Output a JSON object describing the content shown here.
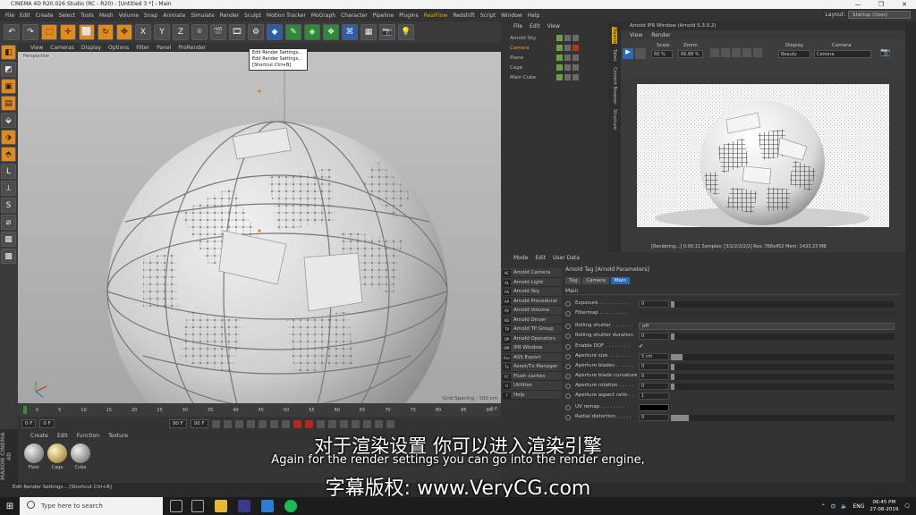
{
  "window": {
    "title": "CINEMA 4D R20.026 Studio (RC - R20) - [Untitled 3 *] - Main",
    "controls": [
      "—",
      "❐",
      "✕"
    ]
  },
  "menubar": {
    "items": [
      "File",
      "Edit",
      "Create",
      "Select",
      "Tools",
      "Mesh",
      "Volume",
      "Snap",
      "Animate",
      "Simulate",
      "Render",
      "Sculpt",
      "Motion Tracker",
      "MoGraph",
      "Character",
      "Pipeline",
      "Plugins"
    ],
    "highlight": "RealFlow",
    "items_after": [
      "Redshift",
      "Script",
      "Window",
      "Help"
    ],
    "layout_label": "Layout:",
    "layout_value": "Startup (User)"
  },
  "toolbar": {
    "tooltip": [
      "Edit Render Settings...",
      "Edit Render Settings...",
      "[Shortcut Ctrl+B]"
    ],
    "axis_x": "X",
    "axis_y": "Y",
    "axis_z": "Z"
  },
  "viewport": {
    "menu": [
      "View",
      "Cameras",
      "Display",
      "Options",
      "Filter",
      "Panel",
      "ProRender"
    ],
    "label": "Perspective",
    "grid_spacing": "Grid Spacing : 100 cm"
  },
  "timeline": {
    "ticks": [
      "0",
      "5",
      "10",
      "15",
      "20",
      "25",
      "30",
      "35",
      "40",
      "45",
      "50",
      "55",
      "60",
      "65",
      "70",
      "75",
      "80",
      "85",
      "90"
    ],
    "end_label": "0 F",
    "start_field": "0 F",
    "min_field": "0 F",
    "max_field": "90 F",
    "max_field2": "90 F"
  },
  "material_manager": {
    "menu": [
      "Create",
      "Edit",
      "Function",
      "Texture"
    ],
    "materials": [
      "Floor",
      "Cage",
      "Cube"
    ]
  },
  "statusbar": {
    "text": "Edit Render Settings... [Shortcut Ctrl+B]"
  },
  "object_manager": {
    "menu": [
      "File",
      "Edit",
      "View"
    ],
    "objects": [
      {
        "name": "Arnold Sky",
        "selected": false
      },
      {
        "name": "Camera",
        "selected": true
      },
      {
        "name": "Plane",
        "selected": false
      },
      {
        "name": "Cage",
        "selected": false
      },
      {
        "name": "Main Cube",
        "selected": false
      }
    ]
  },
  "side_tabs": [
    "Objects",
    "Takes",
    "Content Browser",
    "Structure"
  ],
  "ipr": {
    "title": "Arnold IPR Window (Arnold 5.3.0.2)",
    "menu": [
      "View",
      "Render"
    ],
    "scale_label": "Scale",
    "scale_value": "60 %",
    "zoom_label": "Zoom",
    "zoom_value": "66.88 %",
    "display_label": "Display",
    "display_value": "Beauty",
    "camera_label": "Camera",
    "camera_value": "Camera",
    "status": "[Rendering...] 0:00:11  Samples: [3/2/2/2/2/2]  Res: 768x452  Mem: 1433.23 MB"
  },
  "attributes": {
    "menu": [
      "Mode",
      "Edit",
      "User Data"
    ],
    "plugin_list": [
      {
        "icon": "AC",
        "label": "Arnold Camera"
      },
      {
        "icon": "AL",
        "label": "Arnold Light"
      },
      {
        "icon": "AS",
        "label": "Arnold Sky"
      },
      {
        "icon": "AP",
        "label": "Arnold Procedural"
      },
      {
        "icon": "AV",
        "label": "Arnold Volume"
      },
      {
        "icon": "AD",
        "label": "Arnold Driver"
      },
      {
        "icon": "TP",
        "label": "Arnold TP Group"
      },
      {
        "icon": "OP",
        "label": "Arnold Operators"
      },
      {
        "icon": "IPR",
        "label": "IPR Window"
      },
      {
        "icon": "Ass",
        "label": "ASS Export"
      },
      {
        "icon": "Tx",
        "label": "Asset/Tx Manager"
      },
      {
        "icon": "FC",
        "label": "Flush caches"
      },
      {
        "icon": "U",
        "label": "Utilities"
      },
      {
        "icon": "?",
        "label": "Help"
      }
    ],
    "header": "Arnold Tag [Arnold Parameters]",
    "tabs": [
      "Tag",
      "Camera",
      "Main"
    ],
    "active_tab": "Main",
    "section": "Main",
    "params": [
      {
        "label": "Exposure . . . . . . . . . .",
        "value": "0",
        "kind": "slider",
        "fill": 0
      },
      {
        "label": "Filtermap . . . . . . . . .",
        "value": "",
        "kind": "shader"
      },
      {
        "label": "Rolling shutter . . . . . . .",
        "value": "off",
        "kind": "dropdown"
      },
      {
        "label": "Rolling shutter duration",
        "value": "0",
        "kind": "slider",
        "fill": 0
      },
      {
        "label": "Enable DOF . . . . . . . .",
        "value": "✔",
        "kind": "check"
      },
      {
        "label": "Aperture size . . . . . . .",
        "value": "5 cm",
        "kind": "slider",
        "fill": 0.05
      },
      {
        "label": "Aperture blades . . . . . .",
        "value": "0",
        "kind": "slider",
        "fill": 0
      },
      {
        "label": "Aperture blade curvature",
        "value": "0",
        "kind": "slider",
        "fill": 0
      },
      {
        "label": "Aperture rotation . . . . .",
        "value": "0",
        "kind": "slider",
        "fill": 0
      },
      {
        "label": "Aperture aspect ratio . .",
        "value": "1",
        "kind": "field"
      },
      {
        "label": "UV remap . . . . . . . .",
        "value": "",
        "kind": "color"
      },
      {
        "label": "Radial distortion . . . . .",
        "value": "0",
        "kind": "slider",
        "fill": 0.08
      }
    ]
  },
  "subtitles": {
    "chinese": "对于渲染设置 你可以进入渲染引擎",
    "english": "Again for the render settings you can go into the render engine,",
    "watermark_prefix": "字幕版权:",
    "watermark_url": "www.VeryCG.com"
  },
  "taskbar": {
    "search_placeholder": "Type here to search",
    "lang": "ENG",
    "time": "06:45 PM",
    "date": "27-08-2019"
  }
}
